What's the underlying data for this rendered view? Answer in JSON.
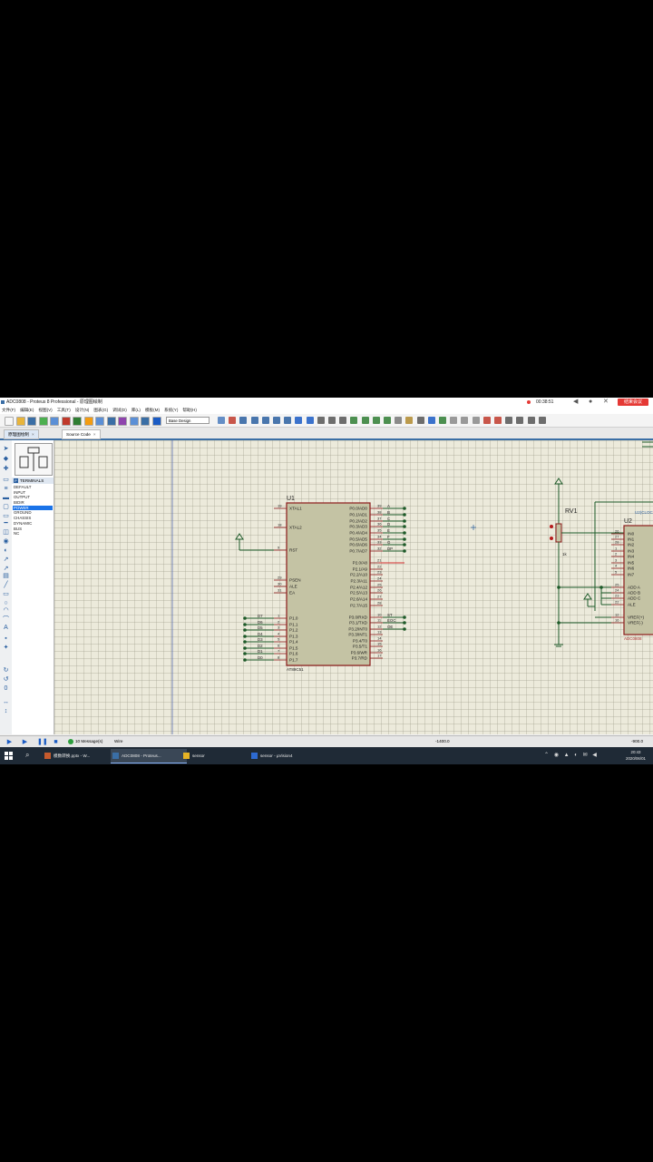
{
  "window": {
    "title": "ADC0808 - Proteus 8 Professional - 原理图绘制",
    "recording_timer": "00:38:51",
    "end_meeting": "结束会议"
  },
  "menu": [
    "文件(F)",
    "编辑(E)",
    "视图(V)",
    "工具(T)",
    "设计(N)",
    "图表(G)",
    "调试(D)",
    "库(L)",
    "模板(M)",
    "系统(Y)",
    "帮助(H)"
  ],
  "toolbar": {
    "design_select": "Base Design"
  },
  "tabs": [
    {
      "label": "原理图绘制",
      "active": true
    },
    {
      "label": "Source Code",
      "active": false
    }
  ],
  "panel": {
    "header": "TERMINALS",
    "items": [
      "DEFAULT",
      "INPUT",
      "OUTPUT",
      "BIDIR",
      "POWER",
      "GROUND",
      "CHASSIS",
      "DYNAMIC",
      "BUS",
      "NC"
    ],
    "selected": "POWER"
  },
  "schematic": {
    "u1": {
      "ref": "U1",
      "part": "AT89C51",
      "left_pins": [
        {
          "num": "19",
          "name": "XTAL1"
        },
        {
          "num": "18",
          "name": "XTAL2"
        },
        {
          "num": "9",
          "name": "RST"
        },
        {
          "num": "29",
          "name": "PSEN"
        },
        {
          "num": "30",
          "name": "ALE"
        },
        {
          "num": "31",
          "name": "EA"
        },
        {
          "num": "1",
          "name": "P1.0"
        },
        {
          "num": "2",
          "name": "P1.1"
        },
        {
          "num": "3",
          "name": "P1.2"
        },
        {
          "num": "4",
          "name": "P1.3"
        },
        {
          "num": "5",
          "name": "P1.4"
        },
        {
          "num": "6",
          "name": "P1.5"
        },
        {
          "num": "7",
          "name": "P1.6"
        },
        {
          "num": "8",
          "name": "P1.7"
        }
      ],
      "right_pins": [
        {
          "num": "39",
          "name": "P0.0/AD0"
        },
        {
          "num": "38",
          "name": "P0.1/AD1"
        },
        {
          "num": "37",
          "name": "P0.2/AD2"
        },
        {
          "num": "36",
          "name": "P0.3/AD3"
        },
        {
          "num": "35",
          "name": "P0.4/AD4"
        },
        {
          "num": "34",
          "name": "P0.5/AD5"
        },
        {
          "num": "33",
          "name": "P0.6/AD6"
        },
        {
          "num": "32",
          "name": "P0.7/AD7"
        },
        {
          "num": "21",
          "name": "P2.0/A8"
        },
        {
          "num": "22",
          "name": "P2.1/A9"
        },
        {
          "num": "23",
          "name": "P2.2/A10"
        },
        {
          "num": "24",
          "name": "P2.3/A11"
        },
        {
          "num": "25",
          "name": "P2.4/A12"
        },
        {
          "num": "26",
          "name": "P2.5/A13"
        },
        {
          "num": "27",
          "name": "P2.6/A14"
        },
        {
          "num": "28",
          "name": "P2.7/A15"
        },
        {
          "num": "10",
          "name": "P3.0/RXD"
        },
        {
          "num": "11",
          "name": "P3.1/TXD"
        },
        {
          "num": "12",
          "name": "P3.2/INT0"
        },
        {
          "num": "13",
          "name": "P3.3/INT1"
        },
        {
          "num": "14",
          "name": "P3.4/T0"
        },
        {
          "num": "15",
          "name": "P3.5/T1"
        },
        {
          "num": "16",
          "name": "P3.6/WR"
        },
        {
          "num": "17",
          "name": "P3.7/RD"
        }
      ],
      "p0_net_labels": [
        "A",
        "B",
        "C",
        "D",
        "E",
        "F",
        "G",
        "DP"
      ],
      "p1_net_labels": [
        "D7",
        "D6",
        "D5",
        "D4",
        "D3",
        "D2",
        "D1",
        "D0"
      ],
      "p3_net_labels": [
        "ST",
        "EOC",
        "OE"
      ]
    },
    "rv1": {
      "ref": "RV1",
      "value": "1k"
    },
    "u2": {
      "ref": "U2",
      "part": "ADC0808",
      "clock_label": "U2(CLOCK)",
      "pins": [
        {
          "num": "26",
          "name": "IN0"
        },
        {
          "num": "27",
          "name": "IN1"
        },
        {
          "num": "28",
          "name": "IN2"
        },
        {
          "num": "1",
          "name": "IN3"
        },
        {
          "num": "2",
          "name": "IN4"
        },
        {
          "num": "3",
          "name": "IN5"
        },
        {
          "num": "4",
          "name": "IN6"
        },
        {
          "num": "5",
          "name": "IN7"
        },
        {
          "num": "25",
          "name": "ADD A"
        },
        {
          "num": "24",
          "name": "ADD B"
        },
        {
          "num": "23",
          "name": "ADD C"
        },
        {
          "num": "22",
          "name": "ALE"
        },
        {
          "num": "12",
          "name": "VREF(+)"
        },
        {
          "num": "16",
          "name": "VREF(-)"
        }
      ]
    }
  },
  "status": {
    "messages": "10 Message(s)",
    "mode": "Wire",
    "coord_center": "-1400.0",
    "coord_right": "-900.0"
  },
  "taskbar": {
    "items": [
      {
        "label": "模数转换.pptx - W...",
        "icon_color": "#c55a2d"
      },
      {
        "label": "ADC0808 - Proteus...",
        "icon_color": "#3a6ea5",
        "active": true
      },
      {
        "label": "sensor",
        "icon_color": "#e6b325"
      },
      {
        "label": "sensor - µVision4",
        "icon_color": "#2d6ad1"
      }
    ],
    "time": "20:43",
    "date": "2020/06/01"
  }
}
